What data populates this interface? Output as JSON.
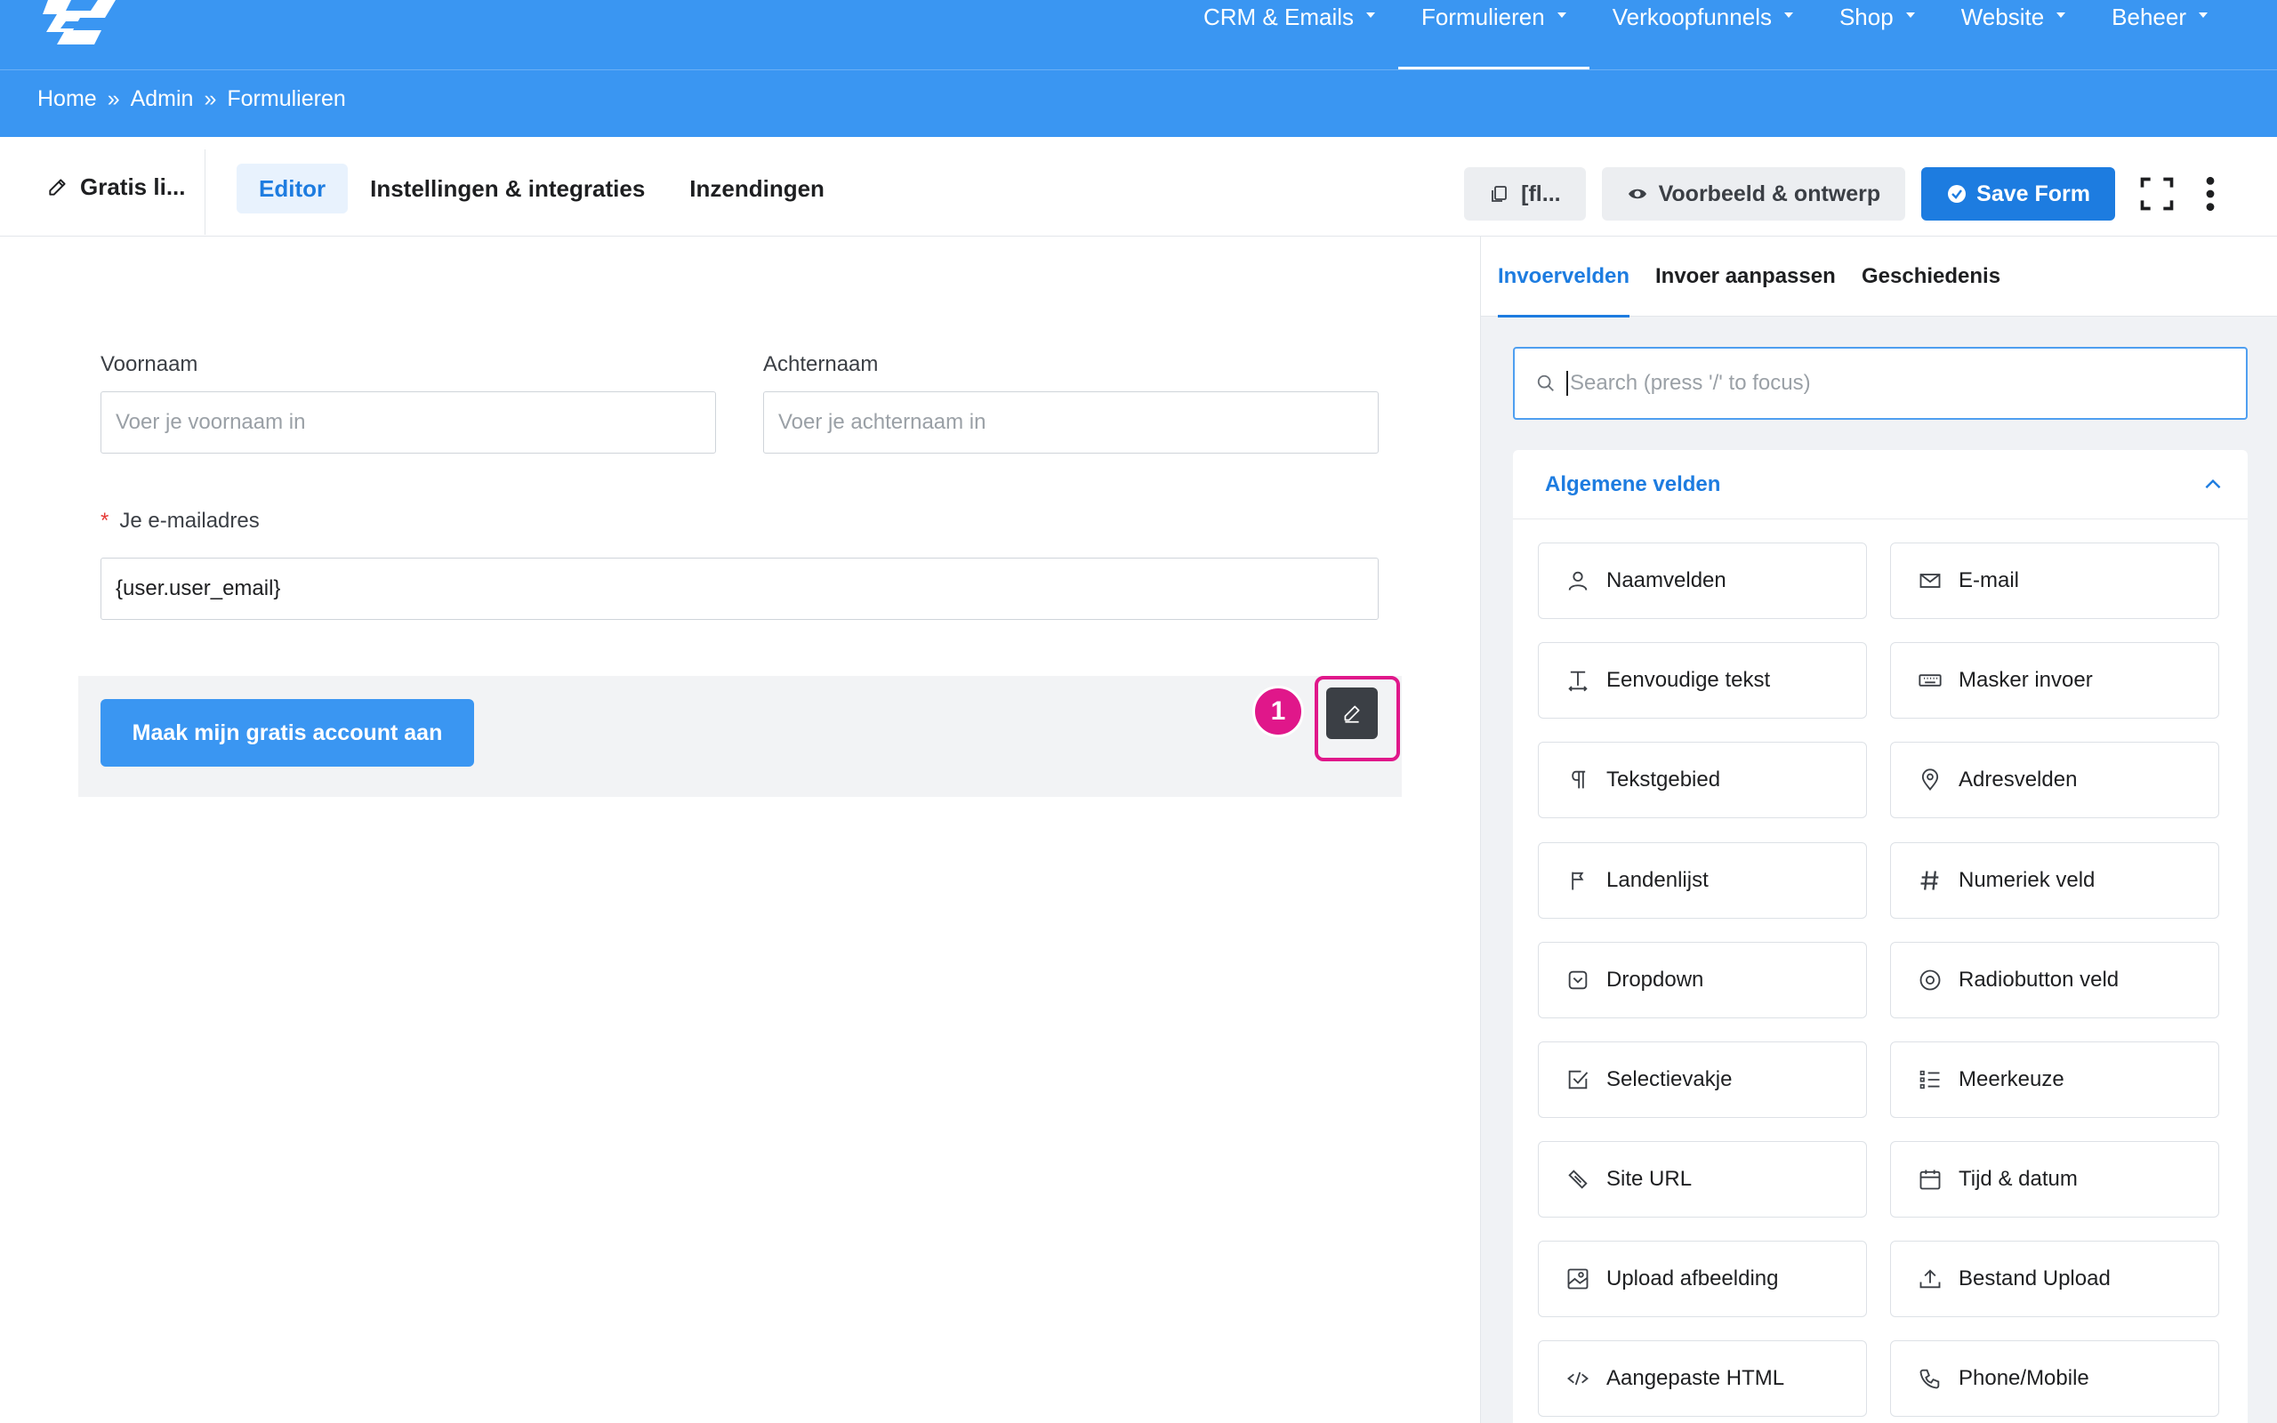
{
  "nav": {
    "items": [
      {
        "label": "CRM & Emails"
      },
      {
        "label": "Formulieren"
      },
      {
        "label": "Verkoopfunnels"
      },
      {
        "label": "Shop"
      },
      {
        "label": "Website"
      },
      {
        "label": "Beheer"
      }
    ]
  },
  "breadcrumb": {
    "items": [
      "Home",
      "Admin",
      "Formulieren"
    ],
    "separator": "»"
  },
  "editor": {
    "form_title": "Gratis li...",
    "tabs": [
      {
        "label": "Editor"
      },
      {
        "label": "Instellingen & integraties"
      },
      {
        "label": "Inzendingen"
      }
    ],
    "shortcode_label": "[fl...",
    "preview_label": "Voorbeeld & ontwerp",
    "save_label": "Save Form"
  },
  "form": {
    "first_name": {
      "label": "Voornaam",
      "placeholder": "Voer je voornaam in"
    },
    "last_name": {
      "label": "Achternaam",
      "placeholder": "Voer je achternaam in"
    },
    "email": {
      "required_mark": "*",
      "label": "Je e-mailadres",
      "value": "{user.user_email}"
    },
    "submit_label": " Maak mijn gratis account aan",
    "step_badge": "1"
  },
  "panel": {
    "tabs": [
      {
        "label": "Invoervelden"
      },
      {
        "label": "Invoer aanpassen"
      },
      {
        "label": "Geschiedenis"
      }
    ],
    "search_placeholder": "Search (press '/' to focus)",
    "group_title": "Algemene velden",
    "fields": [
      {
        "label": "Naamvelden",
        "icon": "user-icon"
      },
      {
        "label": "E-mail",
        "icon": "envelope-icon"
      },
      {
        "label": "Eenvoudige tekst",
        "icon": "text-cursor-icon"
      },
      {
        "label": "Masker invoer",
        "icon": "keyboard-icon"
      },
      {
        "label": "Tekstgebied",
        "icon": "paragraph-icon"
      },
      {
        "label": "Adresvelden",
        "icon": "map-pin-icon"
      },
      {
        "label": "Landenlijst",
        "icon": "flag-icon"
      },
      {
        "label": "Numeriek veld",
        "icon": "hash-icon"
      },
      {
        "label": "Dropdown",
        "icon": "dropdown-icon"
      },
      {
        "label": "Radiobutton veld",
        "icon": "radio-icon"
      },
      {
        "label": "Selectievakje",
        "icon": "checkbox-icon"
      },
      {
        "label": "Meerkeuze",
        "icon": "list-icon"
      },
      {
        "label": "Site URL",
        "icon": "link-icon"
      },
      {
        "label": "Tijd & datum",
        "icon": "calendar-icon"
      },
      {
        "label": "Upload afbeelding",
        "icon": "image-upload-icon"
      },
      {
        "label": "Bestand Upload",
        "icon": "upload-icon"
      },
      {
        "label": "Aangepaste HTML",
        "icon": "code-icon"
      },
      {
        "label": "Phone/Mobile",
        "icon": "phone-icon"
      }
    ]
  },
  "colors": {
    "nav_bg": "#3a96f2",
    "primary": "#1d7ce0",
    "highlight": "#e0178a"
  }
}
